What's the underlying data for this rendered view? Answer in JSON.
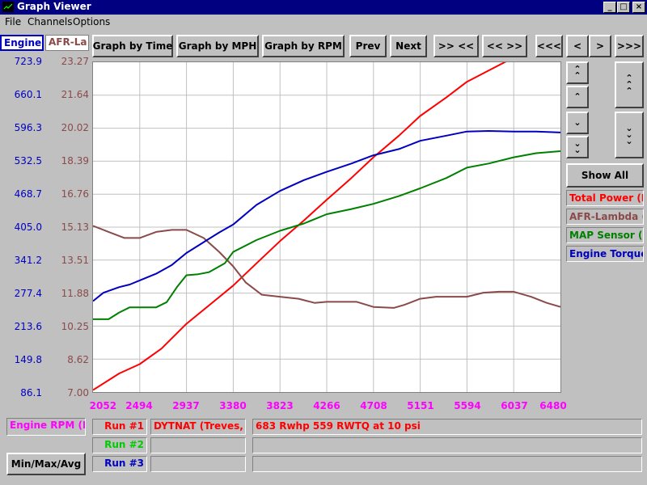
{
  "window": {
    "title": "Graph Viewer",
    "min_label": "_",
    "max_label": "□",
    "close_label": "×"
  },
  "menu": {
    "file_label": "File",
    "channels_label": "Channels",
    "options_label": "Options"
  },
  "axis_tabs": {
    "engine_label": "Engine",
    "afr_label": "AFR-La"
  },
  "toolbar": {
    "by_time": "Graph by Time",
    "by_mph": "Graph by MPH",
    "by_rpm": "Graph by RPM",
    "prev": "Prev",
    "next": "Next",
    "zoom_in": ">> <<",
    "zoom_out": "<< >>",
    "pan_far_left": "<<<",
    "pan_left": "<",
    "pan_right": ">",
    "pan_far_right": ">>>"
  },
  "side": {
    "show_all": "Show All"
  },
  "legend": [
    {
      "label": "Total Power (H",
      "color": "#ff0000"
    },
    {
      "label": "AFR-Lambda (",
      "color": "#8b4a4a"
    },
    {
      "label": "MAP Sensor (k",
      "color": "#008000"
    },
    {
      "label": "Engine Torque",
      "color": "#0000c0"
    }
  ],
  "left_axis_engine": [
    "723.9",
    "660.1",
    "596.3",
    "532.5",
    "468.7",
    "405.0",
    "341.2",
    "277.4",
    "213.6",
    "149.8",
    "86.1"
  ],
  "left_axis_afr": [
    "23.27",
    "21.64",
    "20.02",
    "18.39",
    "16.76",
    "15.13",
    "13.51",
    "11.88",
    "10.25",
    "8.62",
    "7.00"
  ],
  "x_axis_ticks": [
    "2052",
    "2494",
    "2937",
    "3380",
    "3823",
    "4266",
    "4708",
    "5151",
    "5594",
    "6037",
    "6480"
  ],
  "bottom": {
    "x_channel_label": "Engine RPM (R",
    "minmax_label": "Min/Max/Avg",
    "runs": [
      {
        "label": "Run #1",
        "color": "#ff0000",
        "name": "DYTNAT (Treves,",
        "desc": "683 Rwhp 559 RWTQ at 10 psi"
      },
      {
        "label": "Run #2",
        "color": "#00cc00",
        "name": "",
        "desc": ""
      },
      {
        "label": "Run #3",
        "color": "#0000c0",
        "name": "",
        "desc": ""
      }
    ]
  },
  "colors": {
    "engine_axis": "#0000c0",
    "afr_axis": "#8b4a4a",
    "x_axis": "#ff00ff",
    "grid": "#c0c0c0"
  },
  "chart_data": {
    "type": "line",
    "x_label": "Engine RPM",
    "xlim": [
      2052,
      6480
    ],
    "ylim_engine": [
      86.1,
      723.9
    ],
    "ylim_afr": [
      7.0,
      23.27
    ],
    "grid": true,
    "series": [
      {
        "name": "Total Power",
        "color": "#ff0000",
        "axis": "engine",
        "x": [
          2052,
          2300,
          2494,
          2700,
          2937,
          3200,
          3380,
          3600,
          3823,
          4050,
          4266,
          4500,
          4708,
          4950,
          5151,
          5400,
          5594,
          5800,
          6037,
          6250,
          6480
        ],
        "y": [
          90,
          122,
          140,
          170,
          218,
          262,
          292,
          335,
          378,
          418,
          458,
          500,
          540,
          582,
          620,
          656,
          686,
          708,
          733,
          755,
          768
        ]
      },
      {
        "name": "AFR-Lambda",
        "color": "#8b4a4a",
        "axis": "afr",
        "x": [
          2052,
          2200,
          2350,
          2494,
          2650,
          2800,
          2937,
          3100,
          3250,
          3380,
          3500,
          3650,
          3823,
          4000,
          4150,
          4266,
          4400,
          4550,
          4708,
          4900,
          5000,
          5151,
          5300,
          5450,
          5594,
          5750,
          5900,
          6037,
          6200,
          6350,
          6480
        ],
        "y": [
          15.2,
          14.9,
          14.6,
          14.6,
          14.9,
          15.0,
          15.0,
          14.6,
          13.9,
          13.2,
          12.4,
          11.8,
          11.7,
          11.6,
          11.4,
          11.45,
          11.45,
          11.45,
          11.2,
          11.15,
          11.3,
          11.6,
          11.7,
          11.7,
          11.7,
          11.9,
          11.95,
          11.95,
          11.7,
          11.4,
          11.2
        ]
      },
      {
        "name": "MAP Sensor",
        "color": "#008000",
        "axis": "engine",
        "x": [
          2052,
          2200,
          2300,
          2400,
          2494,
          2650,
          2750,
          2850,
          2937,
          3050,
          3150,
          3300,
          3380,
          3600,
          3823,
          4050,
          4266,
          4500,
          4708,
          4950,
          5151,
          5400,
          5594,
          5800,
          6037,
          6250,
          6480
        ],
        "y": [
          227,
          227,
          240,
          250,
          250,
          250,
          260,
          290,
          312,
          314,
          318,
          335,
          357,
          380,
          398,
          412,
          430,
          440,
          450,
          465,
          480,
          500,
          520,
          528,
          540,
          548,
          552
        ]
      },
      {
        "name": "Engine Torque",
        "color": "#0000c0",
        "axis": "engine",
        "x": [
          2052,
          2150,
          2300,
          2400,
          2494,
          2650,
          2800,
          2937,
          3100,
          3250,
          3380,
          3600,
          3823,
          4050,
          4266,
          4500,
          4708,
          4950,
          5151,
          5400,
          5594,
          5800,
          6037,
          6250,
          6480
        ],
        "y": [
          262,
          278,
          289,
          294,
          302,
          315,
          332,
          355,
          376,
          395,
          410,
          448,
          475,
          496,
          512,
          528,
          544,
          556,
          572,
          582,
          590,
          591,
          590,
          590,
          588
        ]
      }
    ]
  }
}
